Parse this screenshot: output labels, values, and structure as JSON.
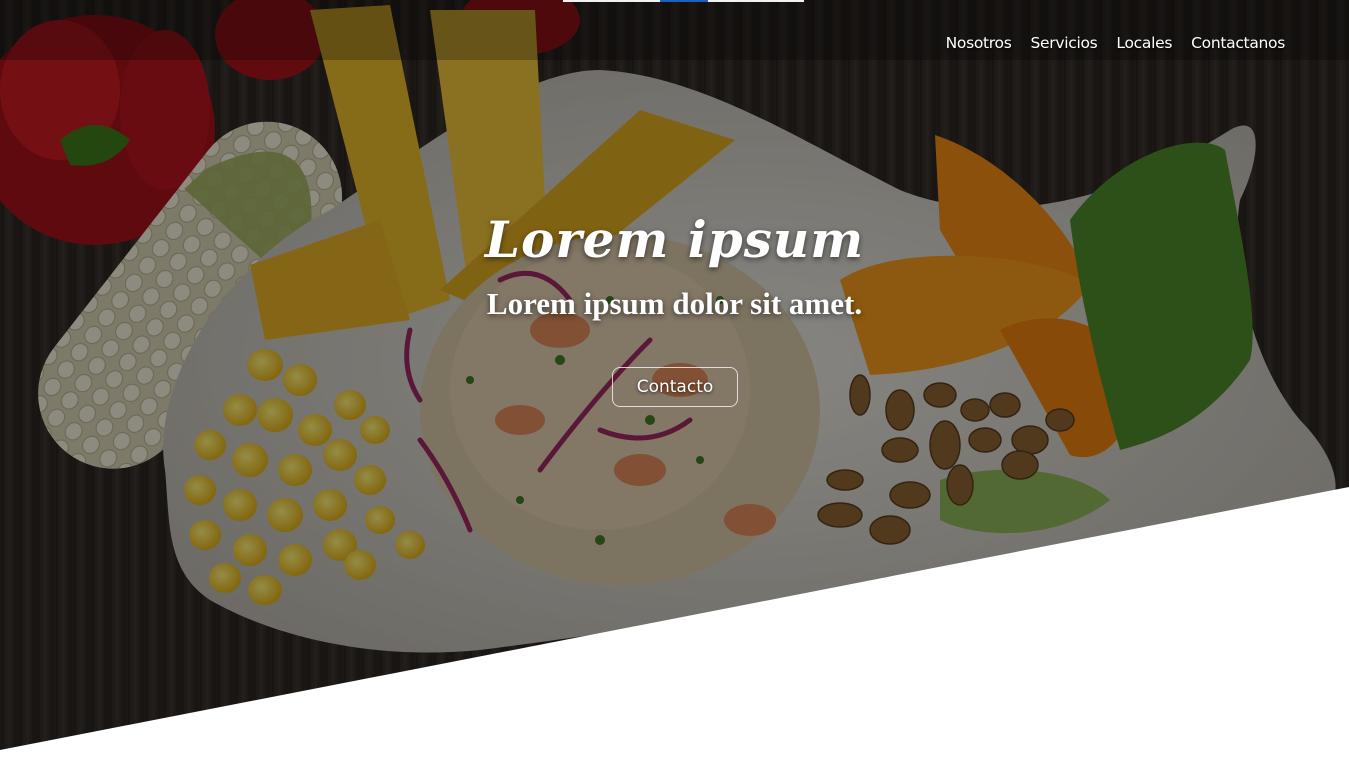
{
  "nav": {
    "items": [
      {
        "label": "Nosotros"
      },
      {
        "label": "Servicios"
      },
      {
        "label": "Locales"
      },
      {
        "label": "Contactanos"
      }
    ]
  },
  "hero": {
    "title": "Lorem ipsum",
    "subtitle": "Lorem ipsum dolor sit amet.",
    "cta_label": "Contacto",
    "image_subject": "plated ceviche with corn, plantain chips, sweet potato, toasted corn and lettuce on dark wood"
  },
  "colors": {
    "overlay": "#000000",
    "section_bg": "#ffffff",
    "topbar": "#f2f2f2",
    "topbar_accent": "#1f5fbf",
    "text": "#ffffff"
  }
}
